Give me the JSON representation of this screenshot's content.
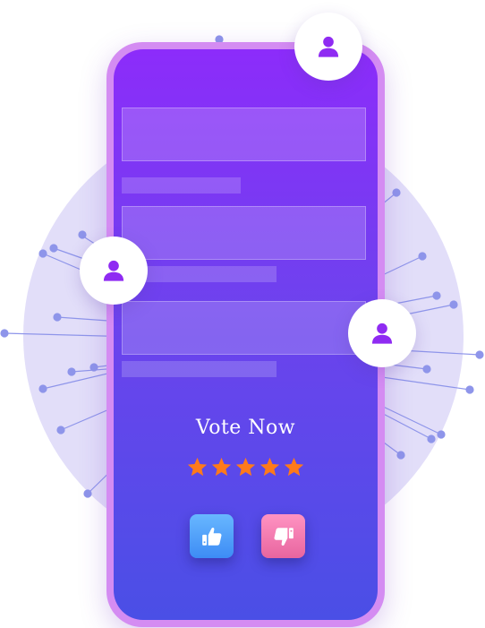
{
  "vote": {
    "title": "Vote Now",
    "rating": 5,
    "max_rating": 5
  },
  "colors": {
    "phone_frame": "#d48cf2",
    "screen_top": "#8c2cfa",
    "screen_bottom": "#4a4fe6",
    "star": "#ff7a1a",
    "thumbs_up": "#4c9cf8",
    "thumbs_down": "#f07aae",
    "avatar_icon": "#8f2bf2",
    "network_bg": "#e2def9",
    "network_line": "#8e95ea"
  },
  "icons": {
    "avatar": "user-icon",
    "star": "star-icon",
    "thumbs_up": "thumbs-up-icon",
    "thumbs_down": "thumbs-down-icon"
  }
}
